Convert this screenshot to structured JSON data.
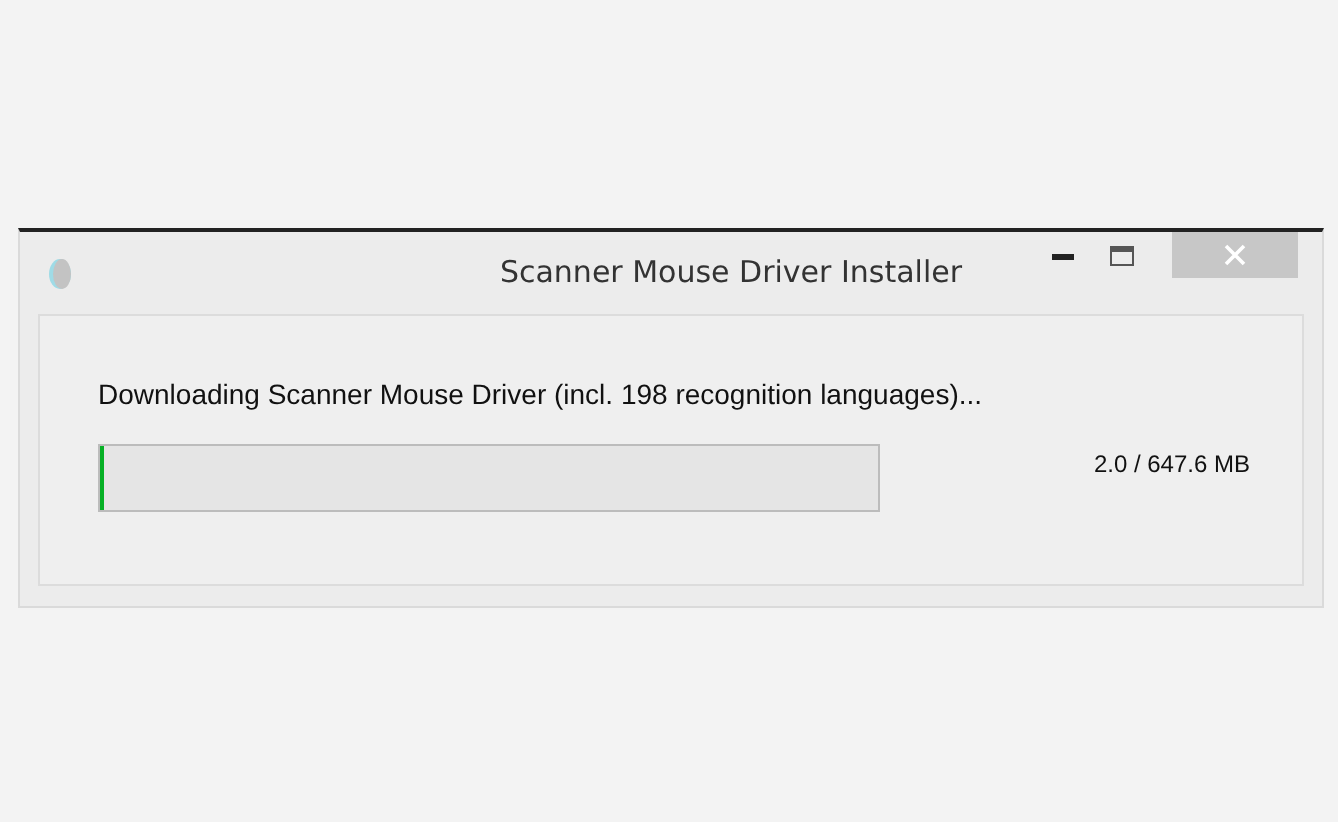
{
  "window": {
    "title": "Scanner Mouse Driver Installer"
  },
  "message": "Downloading Scanner Mouse Driver (incl. 198 recognition languages)...",
  "progress": {
    "level": 0.004,
    "reading": "2.0 / 647.6 MB"
  }
}
